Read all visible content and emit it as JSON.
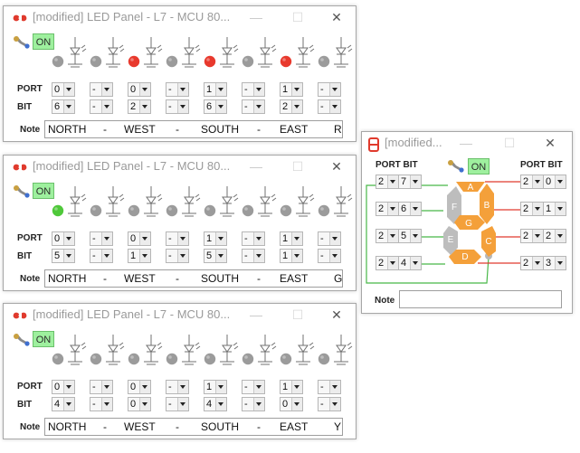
{
  "panels": [
    {
      "title": "[modified] LED Panel - L7 - MCU 80...",
      "on_label": "ON",
      "labels": {
        "port": "PORT",
        "bit": "BIT",
        "note": "Note"
      },
      "leds": [
        "off",
        "off",
        "red",
        "off",
        "red",
        "off",
        "red",
        "off"
      ],
      "port": [
        "0",
        "-",
        "0",
        "-",
        "1",
        "-",
        "1",
        "-"
      ],
      "bit": [
        "6",
        "-",
        "2",
        "-",
        "6",
        "-",
        "2",
        "-"
      ],
      "note": [
        "NORTH",
        "-",
        "WEST",
        "-",
        "SOUTH",
        "-",
        "EAST",
        "R"
      ]
    },
    {
      "title": "[modified] LED Panel - L7 - MCU 80...",
      "on_label": "ON",
      "labels": {
        "port": "PORT",
        "bit": "BIT",
        "note": "Note"
      },
      "leds": [
        "green",
        "off",
        "off",
        "off",
        "off",
        "off",
        "off",
        "off"
      ],
      "port": [
        "0",
        "-",
        "0",
        "-",
        "1",
        "-",
        "1",
        "-"
      ],
      "bit": [
        "5",
        "-",
        "1",
        "-",
        "5",
        "-",
        "1",
        "-"
      ],
      "note": [
        "NORTH",
        "-",
        "WEST",
        "-",
        "SOUTH",
        "-",
        "EAST",
        "G"
      ]
    },
    {
      "title": "[modified] LED Panel - L7 - MCU 80...",
      "on_label": "ON",
      "labels": {
        "port": "PORT",
        "bit": "BIT",
        "note": "Note"
      },
      "leds": [
        "off",
        "off",
        "off",
        "off",
        "off",
        "off",
        "off",
        "off"
      ],
      "port": [
        "0",
        "-",
        "0",
        "-",
        "1",
        "-",
        "1",
        "-"
      ],
      "bit": [
        "4",
        "-",
        "0",
        "-",
        "4",
        "-",
        "0",
        "-"
      ],
      "note": [
        "NORTH",
        "-",
        "WEST",
        "-",
        "SOUTH",
        "-",
        "EAST",
        "Y"
      ]
    }
  ],
  "seven_seg": {
    "title": "[modified...",
    "on_label": "ON",
    "left_header": "PORT BIT",
    "right_header": "PORT BIT",
    "left_rows": [
      [
        "2",
        "7"
      ],
      [
        "2",
        "6"
      ],
      [
        "2",
        "5"
      ],
      [
        "2",
        "4"
      ]
    ],
    "right_rows": [
      [
        "2",
        "0"
      ],
      [
        "2",
        "1"
      ],
      [
        "2",
        "2"
      ],
      [
        "2",
        "3"
      ]
    ],
    "segments": [
      "A",
      "B",
      "C",
      "D",
      "E",
      "F",
      "G"
    ],
    "segments_on": [
      "A",
      "B",
      "C",
      "D",
      "G"
    ],
    "note_label": "Note",
    "note_value": ""
  },
  "colors": {
    "led_red": "#e8392d",
    "led_green": "#4fc83a",
    "led_off": "#9b9b9b",
    "seg_on": "#f4a03a",
    "seg_off": "#bdbdbd",
    "wire": "#48b848",
    "on_bg": "#9ef09e"
  },
  "icons": {
    "logo": "led-panel-logo-icon",
    "wrench": "wrench-icon",
    "minimize": "minimize-icon",
    "maximize": "maximize-icon",
    "close": "close-icon"
  }
}
